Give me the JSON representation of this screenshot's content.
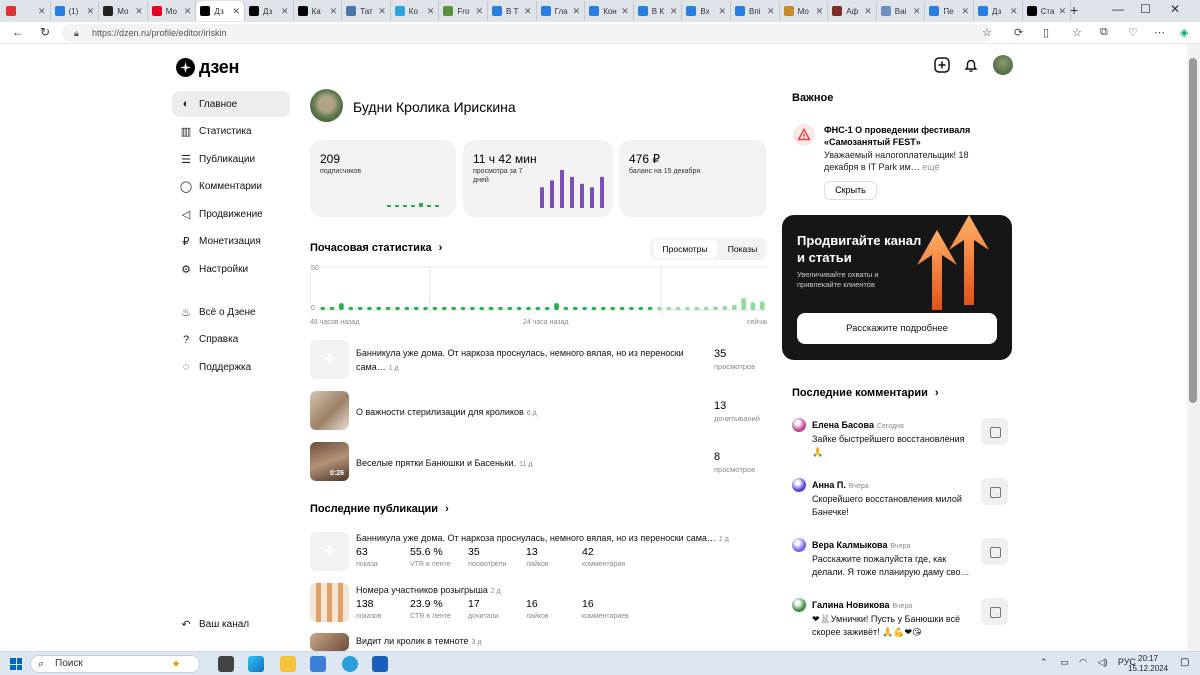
{
  "browser": {
    "tabs": [
      {
        "label": "",
        "color": "#d33"
      },
      {
        "label": "(1)",
        "color": "#2a7de1"
      },
      {
        "label": "Мо",
        "color": "#222"
      },
      {
        "label": "Мо",
        "color": "#e60023"
      },
      {
        "label": "Дз",
        "color": "#000"
      },
      {
        "label": "Дз",
        "color": "#000"
      },
      {
        "label": "Ка",
        "color": "#000"
      },
      {
        "label": "Тат",
        "color": "#4a76a8"
      },
      {
        "label": "Ко",
        "color": "#2aa3e0"
      },
      {
        "label": "Fro",
        "color": "#5a8f3c"
      },
      {
        "label": "В Т",
        "color": "#2a7de1"
      },
      {
        "label": "Гла",
        "color": "#2a7de1"
      },
      {
        "label": "Кон",
        "color": "#2a7de1"
      },
      {
        "label": "В К",
        "color": "#2a7de1"
      },
      {
        "label": "Вх",
        "color": "#2a7de1"
      },
      {
        "label": "Впі",
        "color": "#2a7de1"
      },
      {
        "label": "Мо",
        "color": "#c98b2a"
      },
      {
        "label": "Аф",
        "color": "#7b2d26"
      },
      {
        "label": "Ваі",
        "color": "#6f8fbf"
      },
      {
        "label": "Пе",
        "color": "#2a7de1"
      },
      {
        "label": "Дз",
        "color": "#2a7de1"
      },
      {
        "label": "Ста",
        "color": "#000"
      }
    ],
    "new_tab": "+",
    "url": "https://dzen.ru/profile/editor/iriskin"
  },
  "logo": "дзен",
  "sidebar": {
    "items": [
      {
        "label": "Главное",
        "icon": "planet-icon",
        "glyph": "◐"
      },
      {
        "label": "Статистика",
        "icon": "bar-chart-icon",
        "glyph": "▥"
      },
      {
        "label": "Публикации",
        "icon": "stack-icon",
        "glyph": "☰"
      },
      {
        "label": "Комментарии",
        "icon": "comment-icon",
        "glyph": "◯"
      },
      {
        "label": "Продвижение",
        "icon": "megaphone-icon",
        "glyph": "◁"
      },
      {
        "label": "Монетизация",
        "icon": "ruble-icon",
        "glyph": "₽"
      },
      {
        "label": "Настройки",
        "icon": "gear-icon",
        "glyph": "⚙"
      }
    ],
    "secondary": [
      {
        "label": "Всё о Дзене",
        "icon": "flame-icon",
        "glyph": "♨"
      },
      {
        "label": "Справка",
        "icon": "help-icon",
        "glyph": "?"
      },
      {
        "label": "Поддержка",
        "icon": "support-icon",
        "glyph": "◌"
      }
    ],
    "your_channel": "Ваш канал"
  },
  "channel": {
    "title": "Будни Кролика Ирискина"
  },
  "cards": {
    "subscribers": {
      "value": "209",
      "label": "подписчиков"
    },
    "views": {
      "value": "11 ч 42 мин",
      "label": "просмотра за 7 дней"
    },
    "balance": {
      "value": "476 ₽",
      "label": "баланс на 15 декабря"
    }
  },
  "hourly": {
    "title": "Почасовая статистика",
    "tab_views": "Просмотры",
    "tab_shows": "Показы",
    "y_max": "50",
    "y_min": "0",
    "x_labels": [
      "48 часов назад",
      "24 часа назад",
      "сейчас"
    ]
  },
  "chart_data": {
    "type": "bar",
    "title": "Почасовая статистика",
    "series": [
      {
        "values": [
          2,
          3,
          8,
          1,
          2,
          1,
          2,
          1,
          2,
          1,
          1,
          1,
          2,
          1,
          1,
          2,
          1,
          2,
          2,
          1,
          2,
          2,
          2,
          1,
          2,
          8,
          2,
          2,
          1,
          2,
          1,
          2,
          2,
          1,
          2,
          2,
          1,
          2,
          1,
          1,
          2,
          3,
          4,
          5,
          6,
          14,
          9,
          10
        ]
      }
    ],
    "ylim": [
      0,
      50
    ],
    "spark_subscribers": [
      1,
      1,
      1,
      1,
      2,
      1,
      1
    ],
    "spark_views": [
      12,
      16,
      22,
      18,
      14,
      12,
      18
    ]
  },
  "top_posts": [
    {
      "title": "Банникула уже дома. От наркоза проснулась, немного вялая, но из переноски сама…",
      "age": "1 д",
      "value": "35",
      "label": "просмотров"
    },
    {
      "title": "О важности стерилизации для кроликов",
      "age": "6 д",
      "value": "13",
      "label": "дочитываний"
    },
    {
      "title": "Веселые прятки Банюшки и Басеньки.",
      "age": "11 д",
      "value": "8",
      "label": "просмотров",
      "duration": "0:26"
    }
  ],
  "recent": {
    "title": "Последние публикации",
    "items": [
      {
        "title": "Банникула уже дома. От наркоза проснулась, немного вялая, но из переноски сама…",
        "age": "1 д",
        "metrics": [
          [
            "63",
            "показа"
          ],
          [
            "55.6 %",
            "VTR в ленте"
          ],
          [
            "35",
            "посмотрели"
          ],
          [
            "13",
            "лайков"
          ],
          [
            "42",
            "комментария"
          ]
        ]
      },
      {
        "title": "Номера участников розыгрыша",
        "age": "2 д",
        "metrics": [
          [
            "138",
            "показов"
          ],
          [
            "23.9 %",
            "CTR в ленте"
          ],
          [
            "17",
            "дочитали"
          ],
          [
            "16",
            "лайков"
          ],
          [
            "16",
            "комментариев"
          ]
        ]
      },
      {
        "title": "Видит ли кролик в темноте",
        "age": "3 д",
        "metrics": []
      }
    ]
  },
  "important": {
    "title": "Важное",
    "notice_title": "ФНС-1 О проведении фестиваля «Самозанятый FEST»",
    "notice_body": "Уважаемый налогоплательщик! 18 декабря в IT Park им…",
    "notice_more": "ещё",
    "hide": "Скрыть"
  },
  "promo": {
    "title": "Продвигайте канал и статьи",
    "subtitle": "Увеличивайте охваты и привлекайте клиентов",
    "button": "Расскажите подробнее"
  },
  "comments": {
    "title": "Последние комментарии",
    "items": [
      {
        "name": "Елена Басова",
        "when": "Сегодня",
        "text": "Зайке быстрейшего восстановления 🙏",
        "color": "#c0448f"
      },
      {
        "name": "Анна П.",
        "when": "Вчера",
        "text": "Скорейшего восстановления милой Банечке!",
        "color": "#5b3fd1"
      },
      {
        "name": "Вера Калмыкова",
        "when": "Вчера",
        "text": "Расскажите пожалуйста где, как делали. Я тоже планирую даму сво…",
        "color": "#7b5cf0"
      },
      {
        "name": "Галина Новикова",
        "when": "Вчера",
        "text": "❤🐰Умнички! Пусть у Банюшки всё скорее заживёт! 🙏💪❤😘",
        "color": "#3f8f4a"
      }
    ]
  },
  "taskbar": {
    "search": "Поиск",
    "lang": "РУС",
    "time": "20:17",
    "date": "15.12.2024"
  }
}
